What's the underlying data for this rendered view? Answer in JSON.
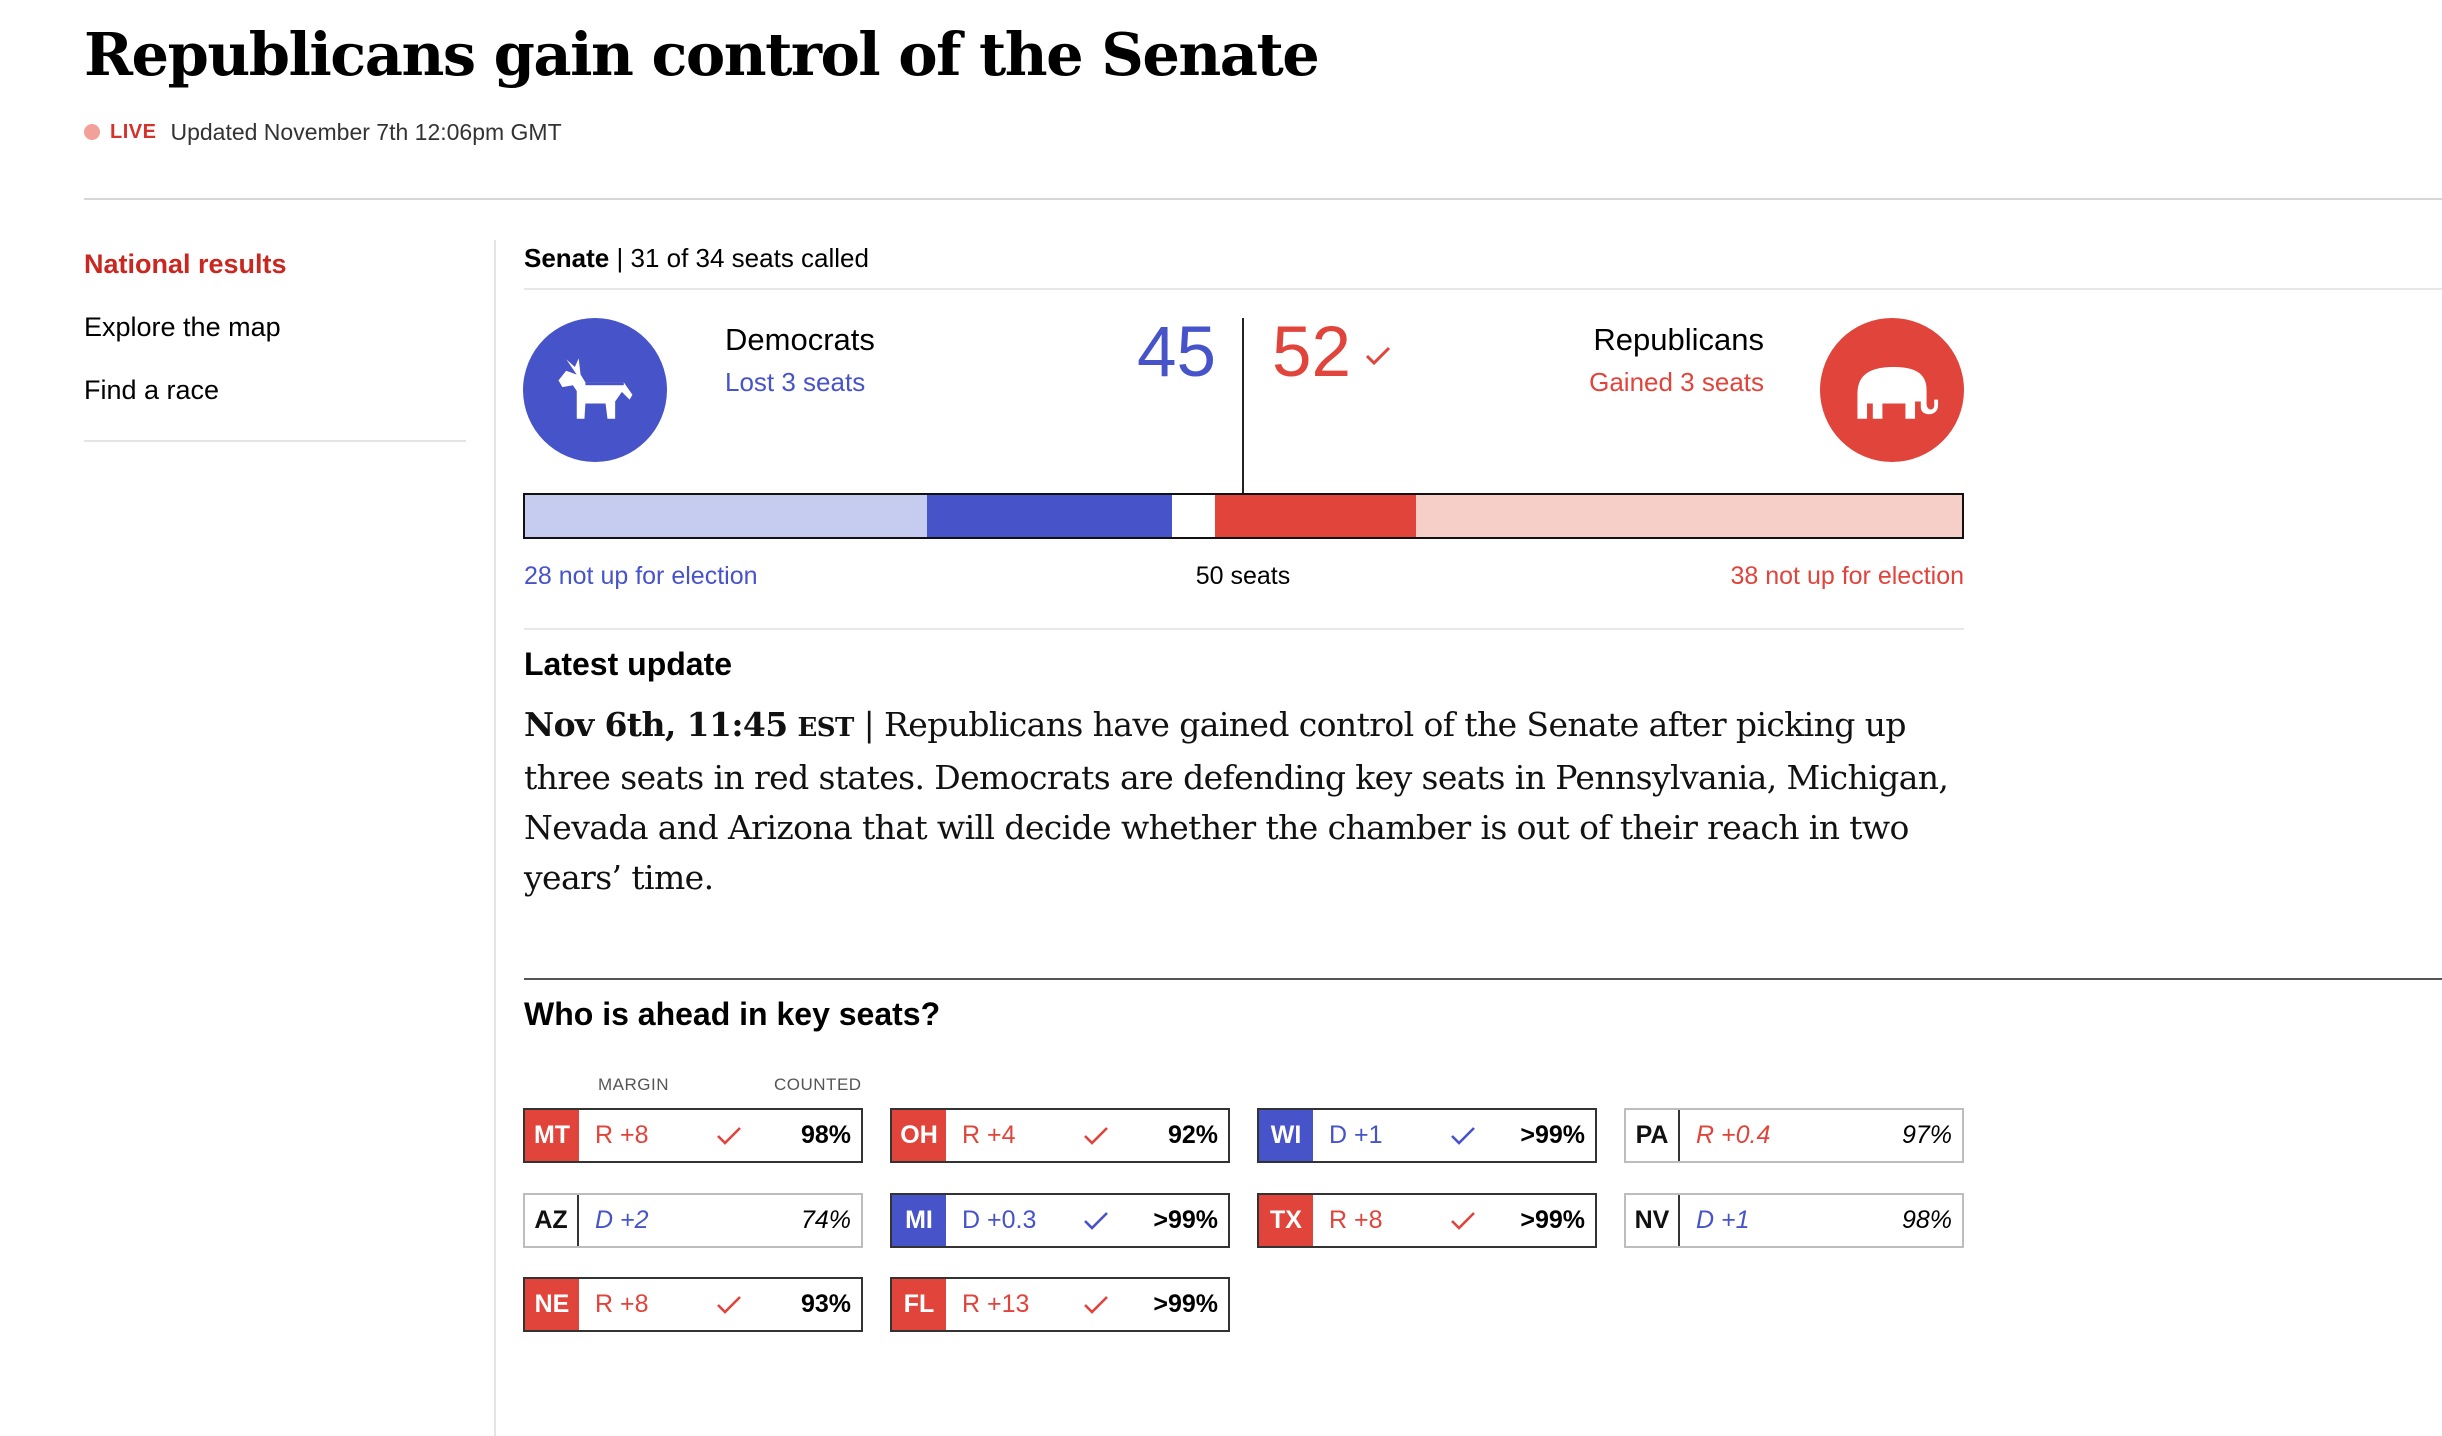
{
  "header": {
    "title": "Republicans gain control of the Senate",
    "live_label": "LIVE",
    "updated": "Updated November 7th 12:06pm GMT"
  },
  "nav": [
    {
      "label": "National results",
      "active": true
    },
    {
      "label": "Explore the map",
      "active": false
    },
    {
      "label": "Find a race",
      "active": false
    }
  ],
  "senate": {
    "chamber": "Senate",
    "called": "31 of 34 seats called",
    "democrats": {
      "name": "Democrats",
      "change": "Lost 3 seats",
      "seats": "45",
      "icon": "donkey-icon"
    },
    "republicans": {
      "name": "Republicans",
      "change": "Gained 3 seats",
      "seats": "52",
      "icon": "elephant-icon"
    },
    "bar": {
      "total": 100,
      "segments": [
        {
          "party": "D",
          "kind": "not-up",
          "seats": 28,
          "color": "#c6ccf0"
        },
        {
          "party": "D",
          "kind": "won",
          "seats": 17,
          "color": "#4753c9"
        },
        {
          "party": "-",
          "kind": "uncalled",
          "seats": 3,
          "color": "#ffffff"
        },
        {
          "party": "R",
          "kind": "won",
          "seats": 14,
          "color": "#e0443b"
        },
        {
          "party": "R",
          "kind": "not-up",
          "seats": 38,
          "color": "#f6cfc8"
        }
      ],
      "majority_line": 50,
      "left_label": "28 not up for election",
      "center_label": "50 seats",
      "right_label": "38 not up for election"
    }
  },
  "latest": {
    "title": "Latest update",
    "timestamp": "Nov 6th, 11:45",
    "tz": "EST",
    "separator": "|",
    "text": "Republicans have gained control of the Senate after picking up three seats in red states. Democrats are defending key seats in Pennsylvania, Michigan, Nevada and Arizona that will decide whether the chamber is out of their reach in two years’ time."
  },
  "key_seats": {
    "title": "Who is ahead in key seats?",
    "col_margin": "MARGIN",
    "col_counted": "COUNTED",
    "seats": [
      {
        "state": "MT",
        "margin": "R +8",
        "party": "R",
        "called": true,
        "counted": "98%"
      },
      {
        "state": "OH",
        "margin": "R +4",
        "party": "R",
        "called": true,
        "counted": "92%"
      },
      {
        "state": "WI",
        "margin": "D +1",
        "party": "D",
        "called": true,
        "counted": ">99%"
      },
      {
        "state": "PA",
        "margin": "R +0.4",
        "party": "R",
        "called": false,
        "counted": "97%"
      },
      {
        "state": "AZ",
        "margin": "D +2",
        "party": "D",
        "called": false,
        "counted": "74%"
      },
      {
        "state": "MI",
        "margin": "D +0.3",
        "party": "D",
        "called": true,
        "counted": ">99%"
      },
      {
        "state": "TX",
        "margin": "R +8",
        "party": "R",
        "called": true,
        "counted": ">99%"
      },
      {
        "state": "NV",
        "margin": "D +1",
        "party": "D",
        "called": false,
        "counted": "98%"
      },
      {
        "state": "NE",
        "margin": "R +8",
        "party": "R",
        "called": true,
        "counted": "93%"
      },
      {
        "state": "FL",
        "margin": "R +13",
        "party": "R",
        "called": true,
        "counted": ">99%"
      }
    ]
  },
  "colors": {
    "dem": "#4753c9",
    "rep": "#e0443b",
    "accent": "#c8281f"
  }
}
